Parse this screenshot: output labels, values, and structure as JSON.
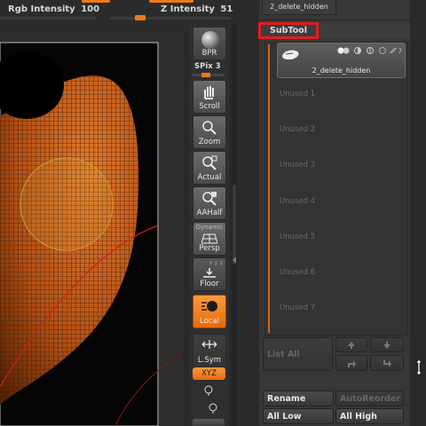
{
  "top_sliders": {
    "rgb_intensity": {
      "label": "Rgb Intensity",
      "value": "100"
    },
    "z_intensity": {
      "label": "Z Intensity",
      "value": "51"
    }
  },
  "shelf": {
    "bpr_label": "BPR",
    "spix_label": "SPix",
    "spix_value": "3",
    "scroll_label": "Scroll",
    "zoom_label": "Zoom",
    "actual_label": "Actual",
    "aahalf_label": "AAHalf",
    "dynamic_label": "Dynamic",
    "persp_label": "Persp",
    "floor_label": "Floor",
    "floor_axes": "x y z",
    "local_label": "Local",
    "lsym_label": "L.Sym",
    "xyz_label": "XYZ"
  },
  "panel": {
    "top_item_label": "2_delete_hidden",
    "subtool_header": "SubTool",
    "active_subtool_name": "2_delete_hidden",
    "unused_slots": [
      "Unused 1",
      "Unused 2",
      "Unused 3",
      "Unused 4",
      "Unused 5",
      "Unused 6",
      "Unused 7"
    ],
    "list_all_label": "List All",
    "rename_label": "Rename",
    "autoreorder_label": "AutoReorder",
    "all_low_label": "All Low",
    "all_high_label": "All High"
  },
  "colors": {
    "accent": "#f07a16",
    "highlight_box": "#e11d1d",
    "mesh": "#d0641e"
  }
}
